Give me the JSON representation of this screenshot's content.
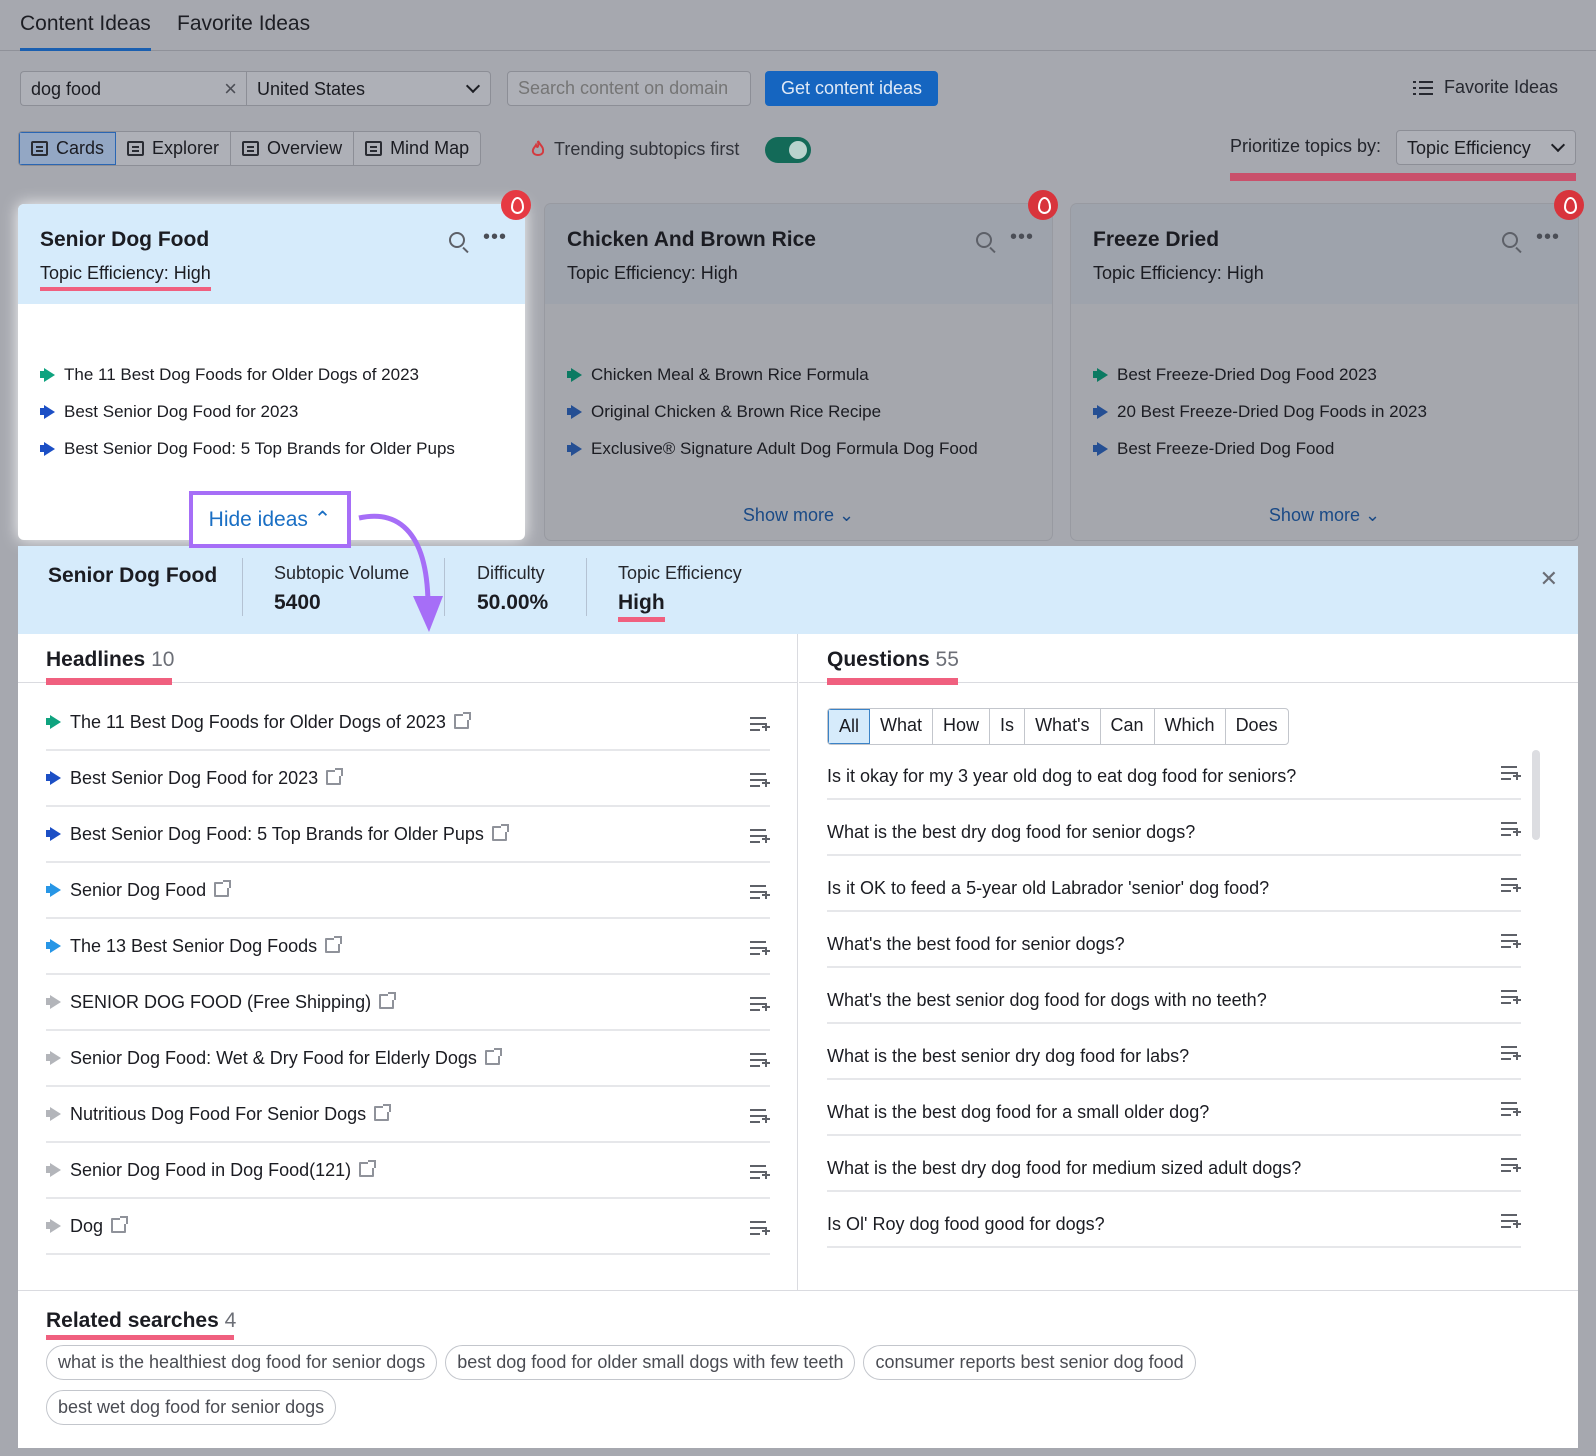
{
  "tabs": {
    "content_ideas": "Content Ideas",
    "favorite_ideas": "Favorite Ideas"
  },
  "search": {
    "keyword": "dog food",
    "country": "United States",
    "domain_placeholder": "Search content on domain",
    "get_button": "Get content ideas",
    "favorites_link": "Favorite Ideas"
  },
  "views": [
    "Cards",
    "Explorer",
    "Overview",
    "Mind Map"
  ],
  "trending_label": "Trending subtopics first",
  "prioritize": {
    "label": "Prioritize topics by:",
    "value": "Topic Efficiency"
  },
  "cards": [
    {
      "title": "Senior Dog Food",
      "efficiency": "Topic Efficiency: High",
      "ideas": [
        "The 11 Best Dog Foods for Older Dogs of 2023",
        "Best Senior Dog Food for 2023",
        "Best Senior Dog Food: 5 Top Brands for Older Pups"
      ],
      "toggle": "Hide ideas"
    },
    {
      "title": "Chicken And Brown Rice",
      "efficiency": "Topic Efficiency: High",
      "ideas": [
        "Chicken Meal & Brown Rice Formula",
        "Original Chicken & Brown Rice Recipe",
        "Exclusive® Signature Adult Dog Formula Dog Food"
      ],
      "toggle": "Show more"
    },
    {
      "title": "Freeze Dried",
      "efficiency": "Topic Efficiency: High",
      "ideas": [
        "Best Freeze-Dried Dog Food 2023",
        "20 Best Freeze-Dried Dog Foods in 2023",
        "Best Freeze-Dried Dog Food"
      ],
      "toggle": "Show more"
    }
  ],
  "detail": {
    "title": "Senior Dog Food",
    "stats": [
      {
        "label": "Subtopic Volume",
        "value": "5400"
      },
      {
        "label": "Difficulty",
        "value": "50.00%"
      },
      {
        "label": "Topic Efficiency",
        "value": "High"
      }
    ],
    "headlines_title": "Headlines",
    "headlines_count": "10",
    "headlines": [
      "The 11 Best Dog Foods for Older Dogs of 2023",
      "Best Senior Dog Food for 2023",
      "Best Senior Dog Food: 5 Top Brands for Older Pups",
      "Senior Dog Food",
      "The 13 Best Senior Dog Foods",
      "SENIOR DOG FOOD (Free Shipping)",
      "Senior Dog Food: Wet & Dry Food for Elderly Dogs",
      "Nutritious Dog Food For Senior Dogs",
      "Senior Dog Food in Dog Food(121)",
      "Dog"
    ],
    "questions_title": "Questions",
    "questions_count": "55",
    "question_filters": [
      "All",
      "What",
      "How",
      "Is",
      "What's",
      "Can",
      "Which",
      "Does"
    ],
    "questions": [
      "Is it okay for my 3 year old dog to eat dog food for seniors?",
      "What is the best dry dog food for senior dogs?",
      "Is it OK to feed a 5-year old Labrador 'senior' dog food?",
      "What's the best food for senior dogs?",
      "What's the best senior dog food for dogs with no teeth?",
      "What is the best senior dry dog food for labs?",
      "What is the best dog food for a small older dog?",
      "What is the best dry dog food for medium sized adult dogs?",
      "Is Ol' Roy dog food good for dogs?"
    ],
    "related_title": "Related searches",
    "related_count": "4",
    "related": [
      "what is the healthiest dog food for senior dogs",
      "best dog food for older small dogs with few teeth",
      "consumer reports best senior dog food",
      "best wet dog food for senior dogs"
    ]
  }
}
